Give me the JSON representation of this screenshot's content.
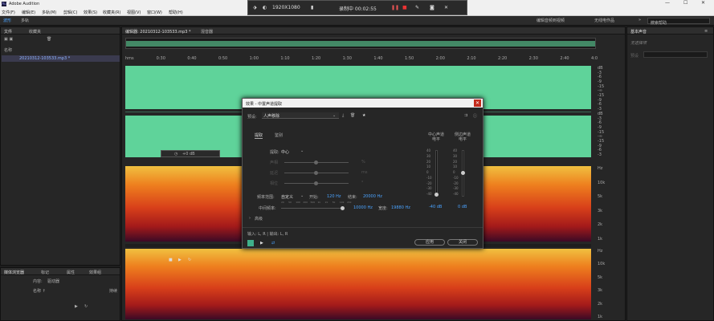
{
  "app": {
    "title": "Adobe Audition"
  },
  "menu": [
    "文件(F)",
    "编辑(E)",
    "多轨(M)",
    "剪辑(C)",
    "效果(S)",
    "收藏夹(R)",
    "视图(V)",
    "窗口(W)",
    "帮助(H)"
  ],
  "recorder": {
    "resolution": "1920X1080",
    "status": "录制中 00:02:55"
  },
  "toolbar": {
    "waveform_tab": "波形",
    "multitrack_tab": "多轨",
    "workspace": "编辑音频到视频",
    "workspace2": "无线电作品",
    "search_placeholder": "搜索帮助"
  },
  "files_panel": {
    "tab_files": "文件",
    "tab_favorites": "收藏夹",
    "header_name": "名称",
    "file_name": "20210312-103533.mp3 *"
  },
  "editor": {
    "tab_editor": "编辑器: 20210312-103533.mp3 *",
    "tab_mixer": "混音器"
  },
  "timeline_ticks": [
    "hms",
    "0:30",
    "0:40",
    "0:50",
    "1:00",
    "1:10",
    "1:20",
    "1:30",
    "1:40",
    "1:50",
    "2:00",
    "2:10",
    "2:20",
    "2:30",
    "2:40",
    "4:0"
  ],
  "db_scale": [
    "dB",
    "-3",
    "-6",
    "-9",
    "-15",
    "-∞",
    "-15",
    "-9",
    "-6",
    "-3",
    "dB",
    "-3",
    "-6",
    "-9",
    "-15",
    "-∞",
    "-15",
    "-9",
    "-6",
    "-3"
  ],
  "hz_scale_1": [
    "Hz",
    "10k",
    "5k",
    "3k",
    "2k",
    "1k"
  ],
  "hz_scale_2": [
    "Hz",
    "10k",
    "5k",
    "3k",
    "2k",
    "1k"
  ],
  "volume_hud": "+0 dB",
  "essential_sound": {
    "title": "基本声音",
    "subtitle": "无选择项",
    "preset_label": "预设"
  },
  "transport": {},
  "media_browser": {
    "tab1": "媒体浏览器",
    "tab2": "标记",
    "tab3": "属性",
    "tab4": "效果组",
    "content_label": "内容:",
    "content_value": "驱动器",
    "name_header": "名称 ↑",
    "duration_header": "持续"
  },
  "dialog": {
    "title": "效果 - 中置声道提取",
    "preset_label": "预设:",
    "preset_value": "人声移除",
    "tab_extract": "提取",
    "tab_identify": "鉴别",
    "extract_label": "提取:",
    "extract_value": "中心",
    "row_labels": [
      "声相",
      "延迟",
      "相位"
    ],
    "row_units": [
      "%",
      "ms",
      "°"
    ],
    "freq_range_label": "频率范围:",
    "freq_range_value": "自定义",
    "start_label": "开始:",
    "start_value": "120 Hz",
    "end_label": "结束:",
    "end_value": "20000 Hz",
    "center_level_label": "中心声道电平",
    "side_level_label": "侧边声道电平",
    "center_db": "-40 dB",
    "side_db": "0 dB",
    "center_freq_label": "中间频率:",
    "center_freq_value": "10000 Hz",
    "width_label": "宽度:",
    "width_value": "19880 Hz",
    "advanced_label": "高级",
    "io_label": "输入: L, R | 输出: L, R",
    "apply": "应用",
    "close": "关闭",
    "meter_scale": [
      "40",
      "30",
      "20",
      "10",
      "0",
      "-10",
      "-20",
      "-30",
      "-40"
    ],
    "freq_ticks": [
      "20",
      "50",
      "100",
      "200",
      "500",
      "1k",
      "2k",
      "5k",
      "10k",
      "20k"
    ]
  }
}
